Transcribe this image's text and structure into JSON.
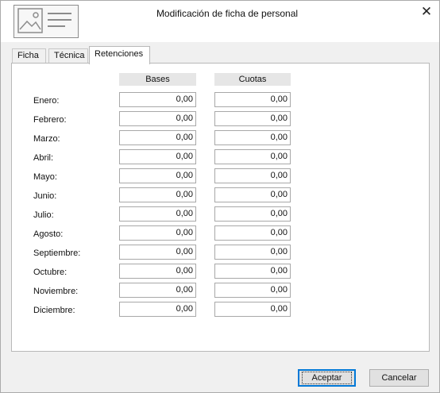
{
  "window": {
    "title": "Modificación de ficha de personal",
    "close_glyph": "✕",
    "icon": "document-card-icon"
  },
  "tabs": [
    {
      "label": "Ficha",
      "active": false
    },
    {
      "label": "Técnica",
      "active": false
    },
    {
      "label": "Retenciones",
      "active": true
    }
  ],
  "retenciones": {
    "headers": {
      "bases": "Bases",
      "cuotas": "Cuotas"
    },
    "rows": [
      {
        "month": "Enero:",
        "bases": "0,00",
        "cuotas": "0,00"
      },
      {
        "month": "Febrero:",
        "bases": "0,00",
        "cuotas": "0,00"
      },
      {
        "month": "Marzo:",
        "bases": "0,00",
        "cuotas": "0,00"
      },
      {
        "month": "Abril:",
        "bases": "0,00",
        "cuotas": "0,00"
      },
      {
        "month": "Mayo:",
        "bases": "0,00",
        "cuotas": "0,00"
      },
      {
        "month": "Junio:",
        "bases": "0,00",
        "cuotas": "0,00"
      },
      {
        "month": "Julio:",
        "bases": "0,00",
        "cuotas": "0,00"
      },
      {
        "month": "Agosto:",
        "bases": "0,00",
        "cuotas": "0,00"
      },
      {
        "month": "Septiembre:",
        "bases": "0,00",
        "cuotas": "0,00"
      },
      {
        "month": "Octubre:",
        "bases": "0,00",
        "cuotas": "0,00"
      },
      {
        "month": "Noviembre:",
        "bases": "0,00",
        "cuotas": "0,00"
      },
      {
        "month": "Diciembre:",
        "bases": "0,00",
        "cuotas": "0,00"
      }
    ]
  },
  "buttons": {
    "accept": "Aceptar",
    "cancel": "Cancelar"
  },
  "colors": {
    "focus_border": "#0078d7",
    "header_bg": "#e6e6e6"
  }
}
